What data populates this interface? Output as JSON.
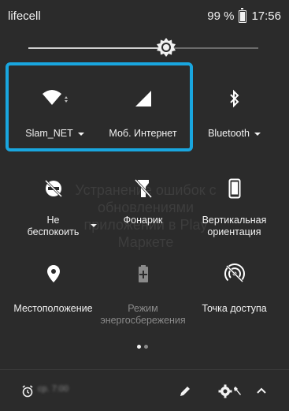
{
  "status_bar": {
    "carrier": "lifecell",
    "battery": "99 %",
    "time": "17:56"
  },
  "brightness": {
    "level": 0.6
  },
  "tiles": [
    {
      "label": "Slam_NET",
      "icon": "wifi-icon",
      "has_dropdown": true
    },
    {
      "label": "Моб. Интернет",
      "icon": "cellular-signal-icon"
    },
    {
      "label": "Bluetooth",
      "icon": "bluetooth-icon",
      "has_dropdown": true
    },
    {
      "label_line1": "Не",
      "label_line2": "беспокоить",
      "icon": "do-not-disturb-icon",
      "has_dropdown": true
    },
    {
      "label": "Фонарик",
      "icon": "flashlight-off-icon"
    },
    {
      "label_line1": "Вертикальная",
      "label_line2": "ориентация",
      "icon": "portrait-lock-icon"
    },
    {
      "label": "Местоположение",
      "icon": "location-pin-icon"
    },
    {
      "label_line1": "Режим",
      "label_line2": "энергосбережения",
      "icon": "battery-saver-icon",
      "disabled": true
    },
    {
      "label": "Точка доступа",
      "icon": "hotspot-off-icon"
    }
  ],
  "background_text": {
    "line1": "Устранение ошибок с",
    "line2": "обновлениями",
    "line3": "приложений в Play",
    "line4": "Маркете"
  },
  "pagination": {
    "pages": 2,
    "current": 1
  },
  "bottom_bar": {
    "alarm_text": "ср. 7:00",
    "icons": [
      "alarm-icon",
      "edit-pencil-icon",
      "settings-gear-icon",
      "wrench-icon",
      "chevron-up-icon"
    ]
  },
  "colors": {
    "highlight": "#19a6df",
    "background": "#2b2b2b",
    "icon": "#ffffff",
    "disabled": "#8a8a8a"
  }
}
